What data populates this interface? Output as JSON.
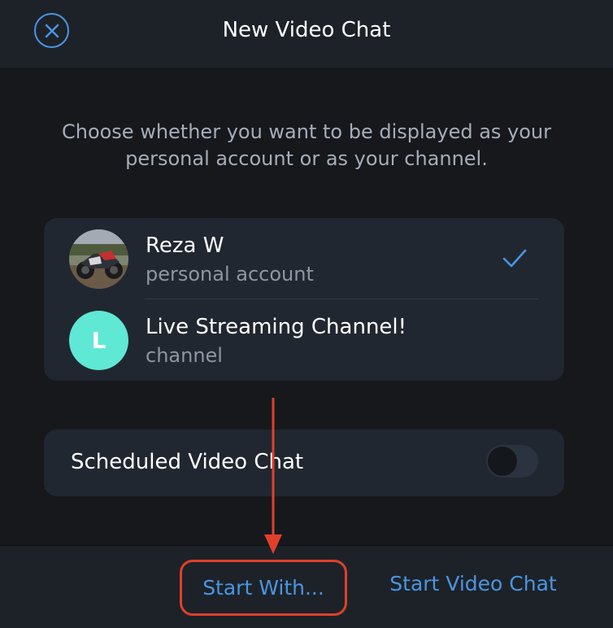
{
  "header": {
    "title": "New Video Chat",
    "close_icon": "close-icon"
  },
  "description": "Choose whether you want to be displayed as your personal account or as your channel.",
  "accounts": [
    {
      "name": "Reza W",
      "subtitle": "personal account",
      "avatar": "motorcycle-photo",
      "selected": true
    },
    {
      "name": "Live Streaming Channel!",
      "subtitle": "channel",
      "avatar_letter": "L",
      "avatar_color": "#5fe8d4",
      "selected": false
    }
  ],
  "scheduled": {
    "label": "Scheduled Video Chat",
    "enabled": false
  },
  "footer": {
    "start_with_label": "Start With...",
    "start_video_label": "Start Video Chat"
  },
  "colors": {
    "accent": "#4a95e0",
    "annotation": "#e0402a",
    "background": "#16181c",
    "card": "#212730"
  }
}
